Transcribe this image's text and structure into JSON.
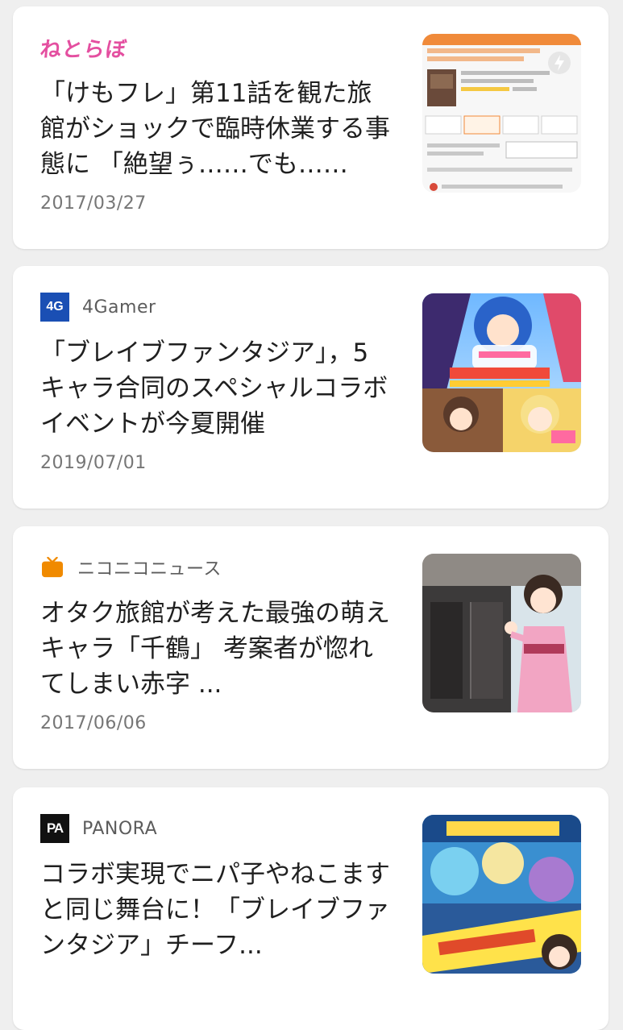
{
  "articles": [
    {
      "source": "ねとらぼ",
      "headline": "「けもフレ」第11話を観た旅館がショックで臨時休業する事態に 「絶望ぅ……でも……",
      "date": "2017/03/27",
      "thumb_icon": "hotel-page-screenshot"
    },
    {
      "source": "4Gamer",
      "logo_text": "4G",
      "headline": "「ブレイブファンタジア」，5キャラ合同のスペシャルコラボイベントが今夏開催",
      "date": "2019/07/01",
      "thumb_icon": "anime-collab-art"
    },
    {
      "source": "ニコニコニュース",
      "headline": "オタク旅館が考えた最強の萌えキャラ「千鶴」 考案者が惚れてしまい赤字 ...",
      "date": "2017/06/06",
      "thumb_icon": "kimono-character-art"
    },
    {
      "source": "PANORA",
      "logo_text": "PA",
      "headline": "コラボ実現でニパ子やねこますと同じ舞台に！「ブレイブファンタジア」チーフ...",
      "date": "",
      "thumb_icon": "game-banner-art"
    }
  ],
  "colors": {
    "background": "#efefef",
    "card": "#ffffff",
    "netorabo_pink": "#e44fa0",
    "gamer_blue": "#1a4fb4",
    "nico_orange": "#f08a00"
  }
}
